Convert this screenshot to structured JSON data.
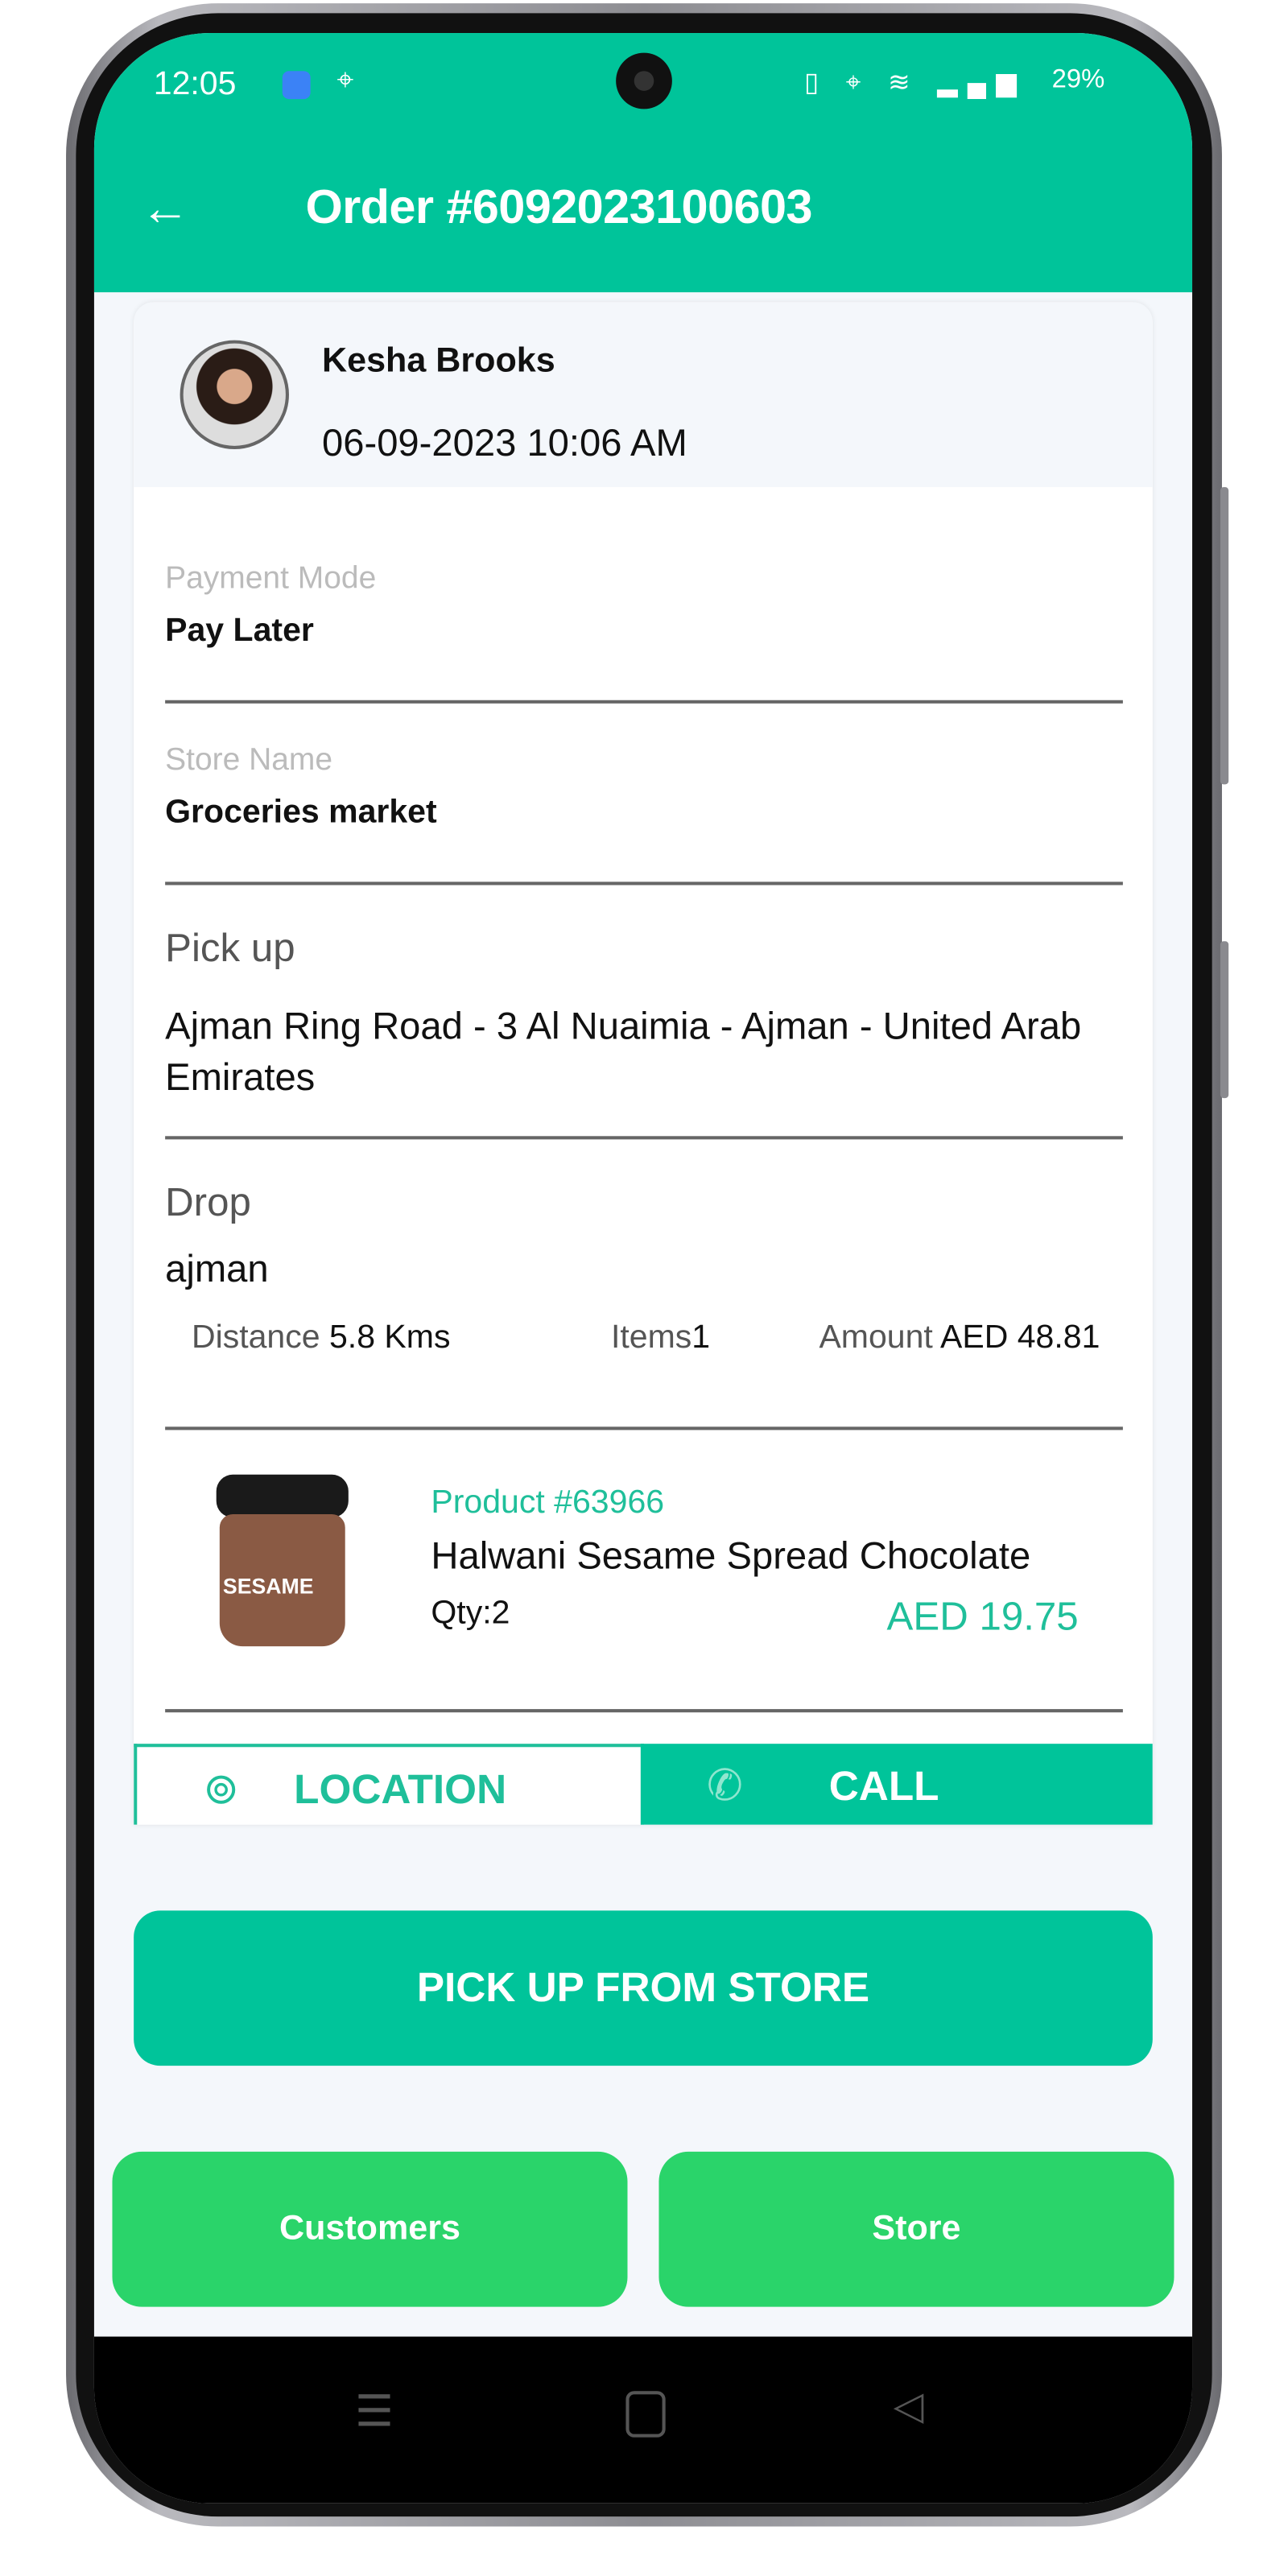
{
  "status_bar": {
    "time": "12:05",
    "battery": "29%"
  },
  "header": {
    "title": "Order #6092023100603",
    "back_icon": "arrow-left-icon"
  },
  "customer": {
    "name": "Kesha  Brooks",
    "date": "06-09-2023 10:06 AM"
  },
  "payment": {
    "label": "Payment Mode",
    "value": "Pay Later"
  },
  "store": {
    "label": "Store Name",
    "value": "Groceries market"
  },
  "pickup": {
    "label": "Pick up",
    "value": "Ajman Ring Road - 3 Al Nuaimia - Ajman - United Arab Emirates"
  },
  "drop": {
    "label": "Drop",
    "value": "ajman"
  },
  "stats": {
    "distance_label": "Distance",
    "distance_value": "5.8 Kms",
    "items_label": "Items",
    "items_value": "1",
    "amount_label": "Amount",
    "amount_value": "AED 48.81"
  },
  "product": {
    "id": "Product #63966",
    "name": "Halwani Sesame Spread Chocolate",
    "qty": "Qty:2",
    "price": "AED 19.75",
    "jar_label": "SESAME"
  },
  "actions": {
    "location": "LOCATION",
    "call": "CALL",
    "pickup_button": "PICK UP FROM STORE",
    "customers": "Customers",
    "store": "Store"
  },
  "colors": {
    "primary": "#00C49A",
    "secondary": "#2AD46A",
    "background": "#F4F7FB"
  }
}
